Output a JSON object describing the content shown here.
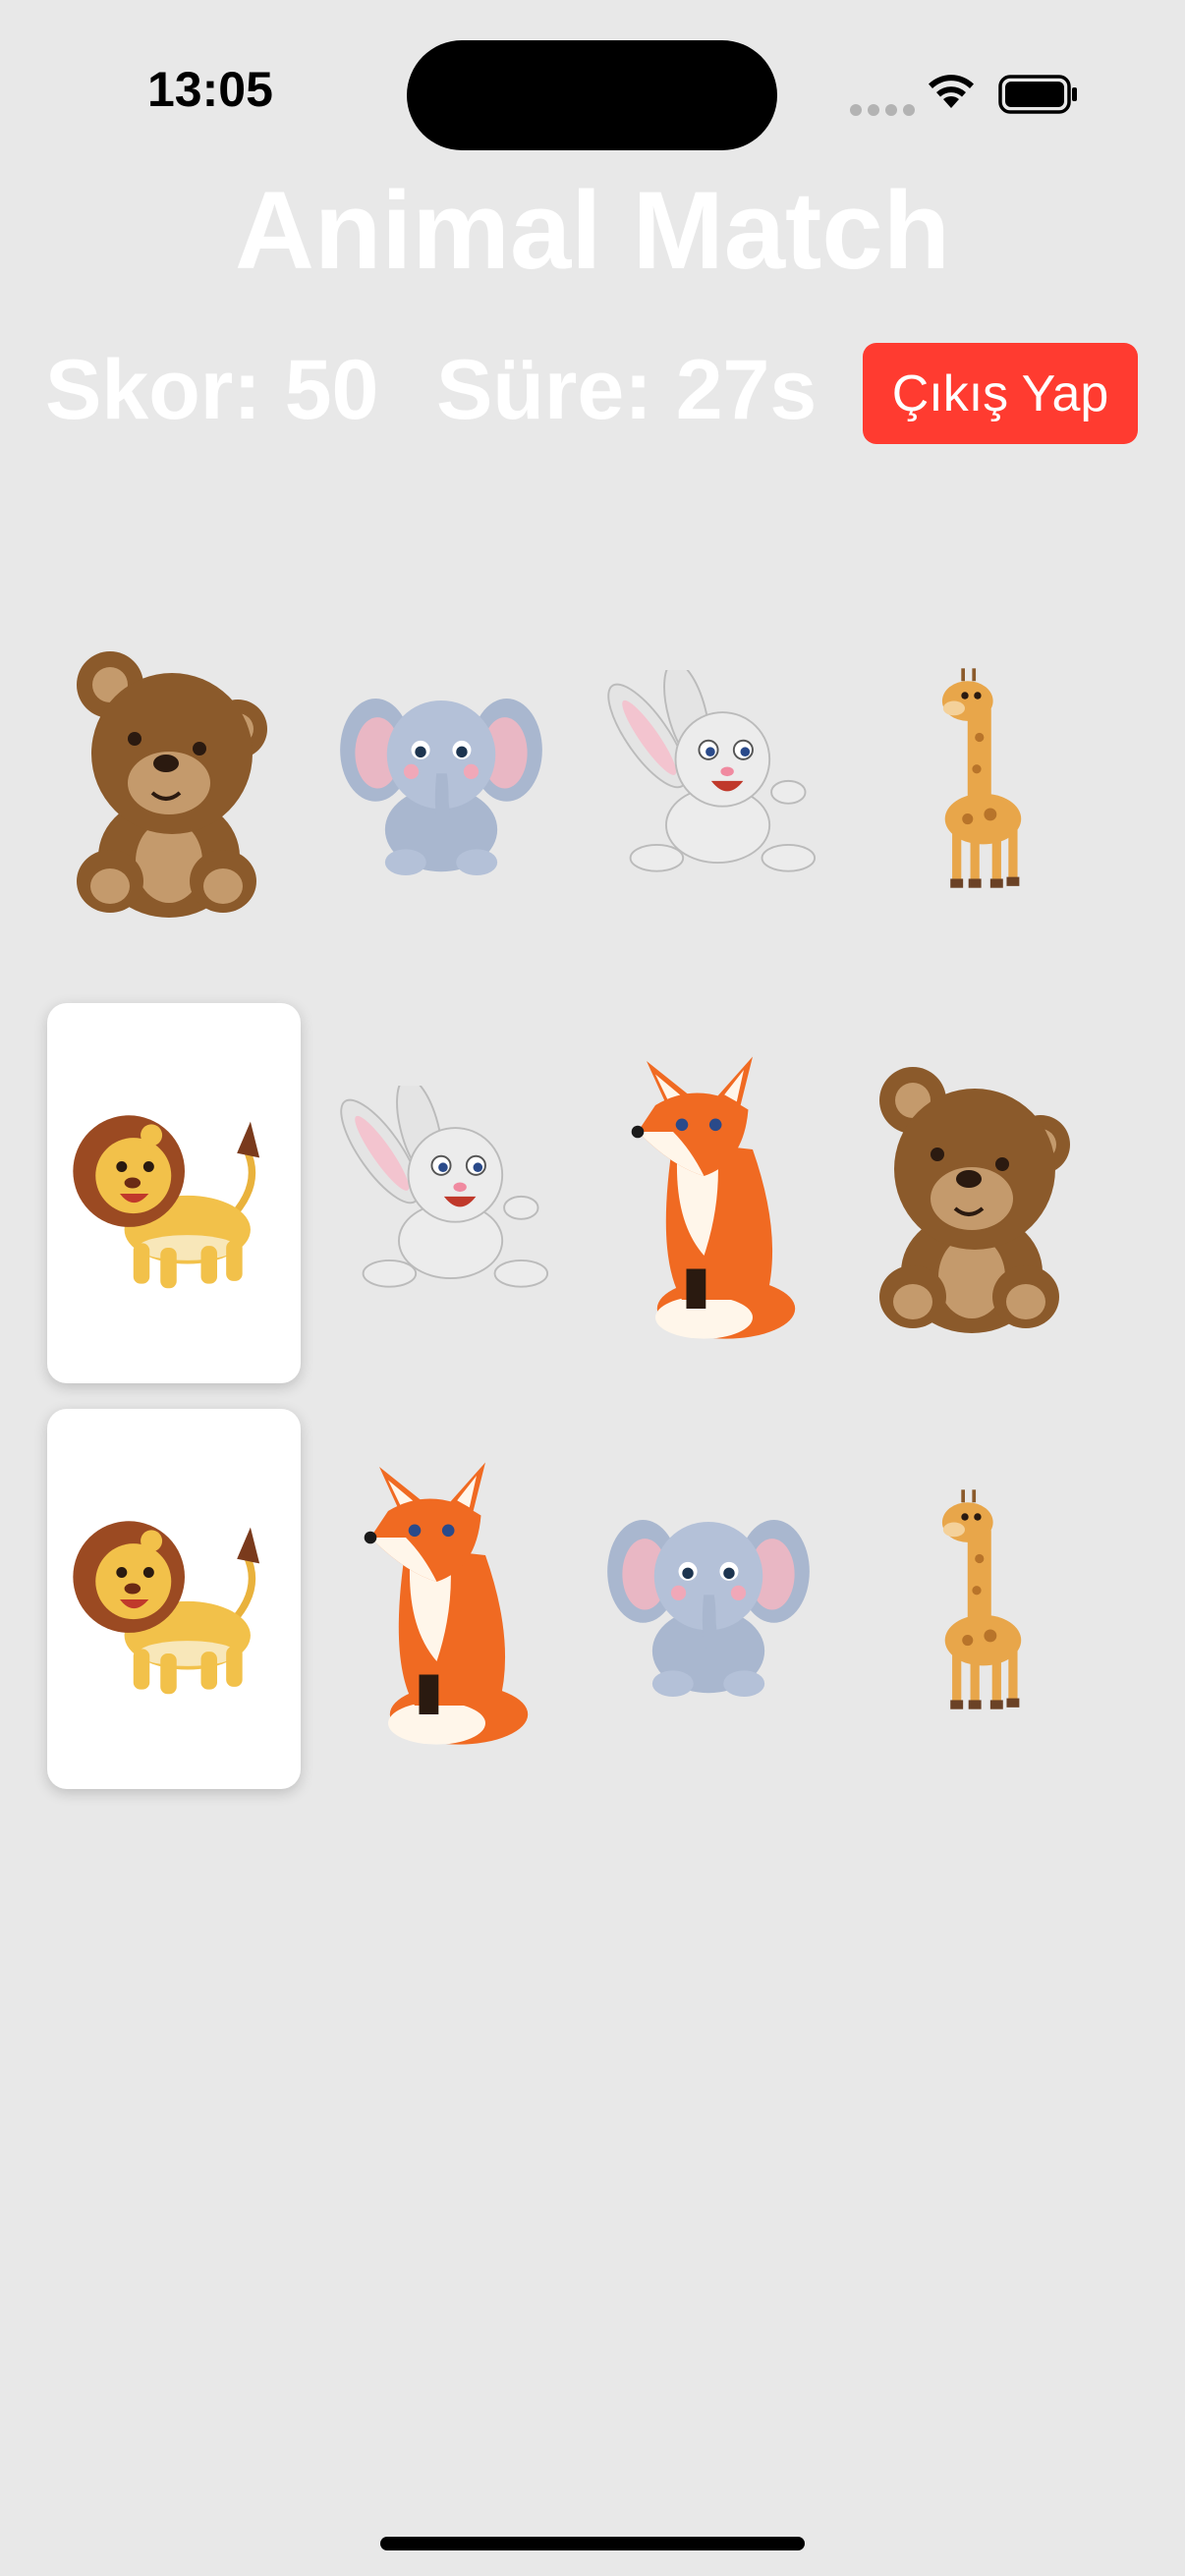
{
  "status_bar": {
    "time": "13:05"
  },
  "header": {
    "title": "Animal Match"
  },
  "stats": {
    "score_text": "Skor: 50",
    "time_text": "Süre: 27s"
  },
  "actions": {
    "exit_label": "Çıkış Yap",
    "exit_color": "#ff3b30"
  },
  "cards": [
    {
      "animal": "bear",
      "face_up": false
    },
    {
      "animal": "elephant",
      "face_up": false
    },
    {
      "animal": "rabbit",
      "face_up": false
    },
    {
      "animal": "giraffe",
      "face_up": false
    },
    {
      "animal": "lion",
      "face_up": true
    },
    {
      "animal": "rabbit",
      "face_up": false
    },
    {
      "animal": "fox",
      "face_up": false
    },
    {
      "animal": "bear",
      "face_up": false
    },
    {
      "animal": "lion",
      "face_up": true
    },
    {
      "animal": "fox",
      "face_up": false
    },
    {
      "animal": "elephant",
      "face_up": false
    },
    {
      "animal": "giraffe",
      "face_up": false
    }
  ]
}
